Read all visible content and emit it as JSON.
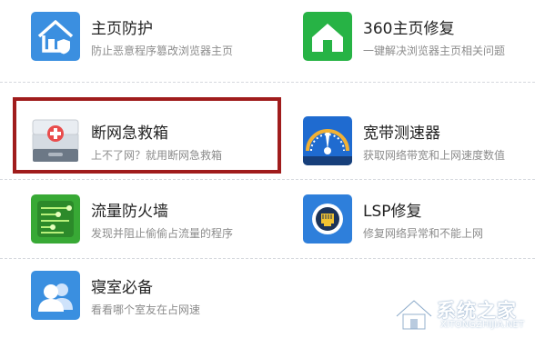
{
  "tools": [
    {
      "name": "主页防护",
      "desc": "防止恶意程序篡改浏览器主页",
      "icon": "home-shield-icon",
      "color": "#3b8fe0"
    },
    {
      "name": "360主页修复",
      "desc": "一键解决浏览器主页相关问题",
      "icon": "green-home-icon",
      "color": "#27b345"
    },
    {
      "name": "断网急救箱",
      "desc": "上不了网？就用断网急救箱",
      "icon": "first-aid-kit-icon",
      "color": "#e94c4c"
    },
    {
      "name": "宽带测速器",
      "desc": "获取网络带宽和上网速度数值",
      "icon": "speedometer-icon",
      "color": "#1f6bd0"
    },
    {
      "name": "流量防火墙",
      "desc": "发现并阻止偷偷占流量的程序",
      "icon": "traffic-firewall-icon",
      "color": "#38a935"
    },
    {
      "name": "LSP修复",
      "desc": "修复网络异常和不能上网",
      "icon": "network-port-icon",
      "color": "#2e7fdb"
    },
    {
      "name": "寝室必备",
      "desc": "看看哪个室友在占网速",
      "icon": "roommates-icon",
      "color": "#3a8fe0"
    }
  ],
  "highlighted_tool": "断网急救箱",
  "watermark": {
    "text": "系统之家",
    "url": "XITONGZHIJIA.NET"
  }
}
